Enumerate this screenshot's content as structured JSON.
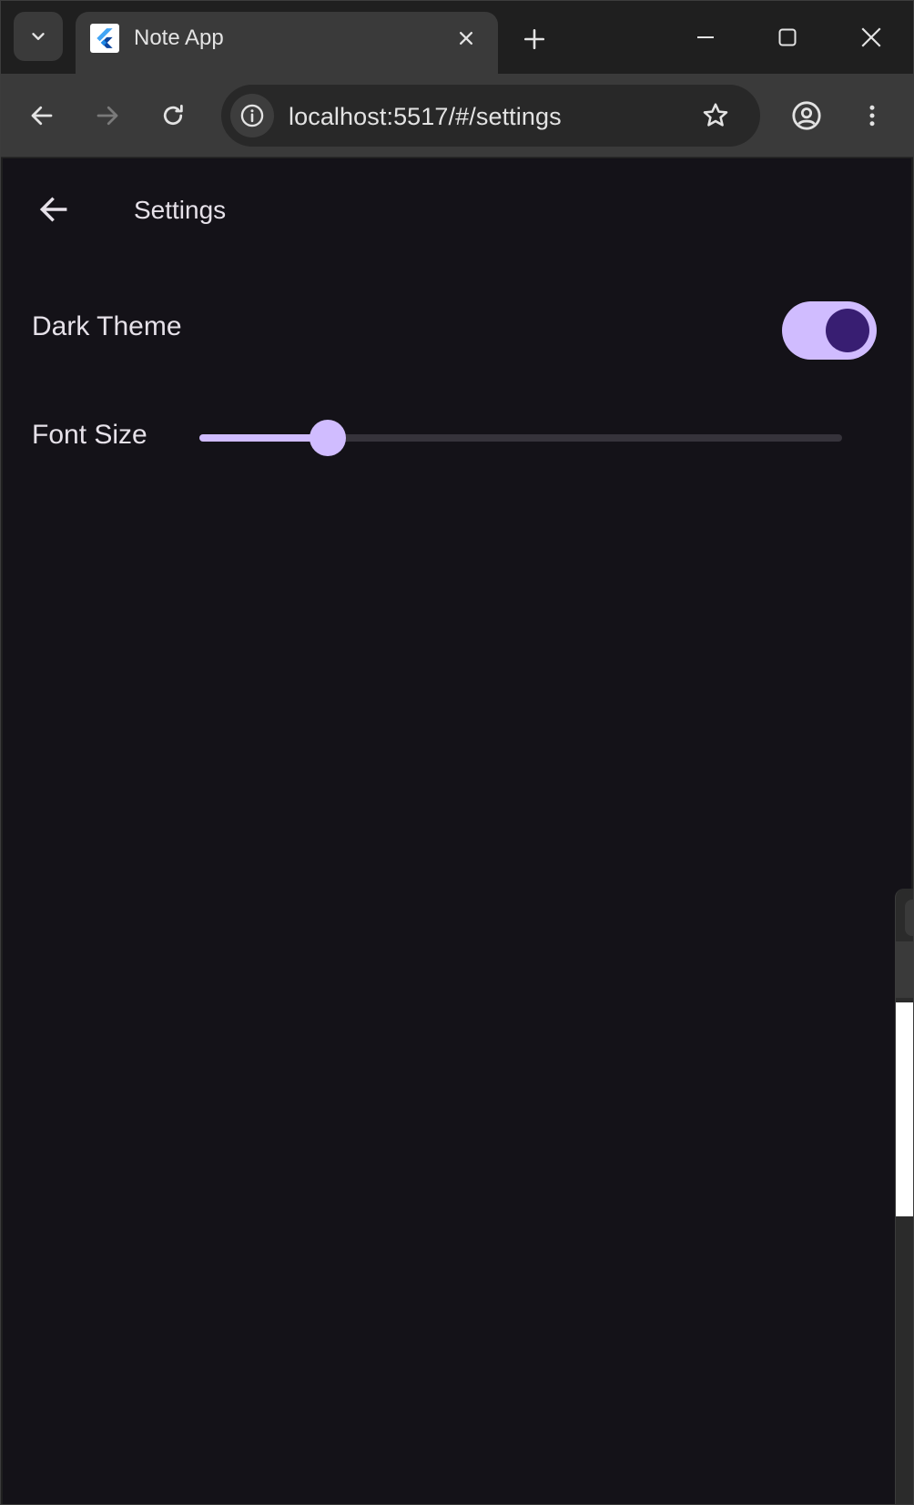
{
  "browser": {
    "tab_title": "Note App",
    "url": "localhost:5517/#/settings"
  },
  "app": {
    "page_title": "Settings",
    "settings": {
      "dark_theme": {
        "label": "Dark Theme",
        "enabled": true
      },
      "font_size": {
        "label": "Font Size",
        "slider_value": 0.2
      }
    }
  },
  "colors": {
    "app_background": "#141218",
    "primary": "#d0bcff",
    "switch_thumb": "#381e72",
    "track_inactive": "#36333b",
    "text": "#e6e1e9"
  },
  "icons": {
    "tab_search": "chevron-down-icon",
    "favicon": "flutter-logo-icon",
    "tab_close": "close-icon",
    "new_tab": "plus-icon",
    "minimize": "minimize-icon",
    "maximize": "maximize-icon",
    "close_window": "close-icon",
    "back": "arrow-left-icon",
    "forward": "arrow-right-icon",
    "reload": "reload-icon",
    "site_info": "info-icon",
    "bookmark": "star-icon",
    "profile": "account-icon",
    "menu": "more-vert-icon",
    "app_back": "arrow-left-icon"
  }
}
